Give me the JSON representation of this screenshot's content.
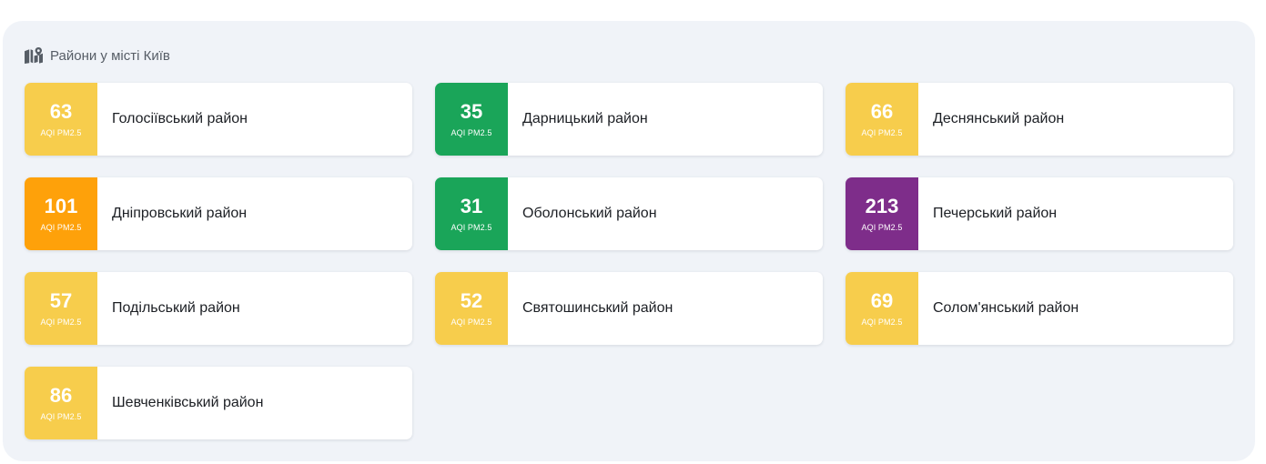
{
  "section": {
    "icon": "map-icon",
    "title": "Райони у місті Київ"
  },
  "aqi_colors": {
    "moderate": "#f7cd4c",
    "good": "#1aa559",
    "unhealthy_sensitive": "#fea10a",
    "very_unhealthy": "#7e2d8a"
  },
  "districts": [
    {
      "name": "Голосіївський район",
      "aqi": "63",
      "label": "AQI PM2.5",
      "level": "moderate"
    },
    {
      "name": "Дарницький район",
      "aqi": "35",
      "label": "AQI PM2.5",
      "level": "good"
    },
    {
      "name": "Деснянський район",
      "aqi": "66",
      "label": "AQI PM2.5",
      "level": "moderate"
    },
    {
      "name": "Дніпровський район",
      "aqi": "101",
      "label": "AQI PM2.5",
      "level": "unhealthy_sensitive"
    },
    {
      "name": "Оболонський район",
      "aqi": "31",
      "label": "AQI PM2.5",
      "level": "good"
    },
    {
      "name": "Печерський район",
      "aqi": "213",
      "label": "AQI PM2.5",
      "level": "very_unhealthy"
    },
    {
      "name": "Подільський район",
      "aqi": "57",
      "label": "AQI PM2.5",
      "level": "moderate"
    },
    {
      "name": "Святошинський район",
      "aqi": "52",
      "label": "AQI PM2.5",
      "level": "moderate"
    },
    {
      "name": "Солом'янський район",
      "aqi": "69",
      "label": "AQI PM2.5",
      "level": "moderate"
    },
    {
      "name": "Шевченківський район",
      "aqi": "86",
      "label": "AQI PM2.5",
      "level": "moderate"
    }
  ]
}
